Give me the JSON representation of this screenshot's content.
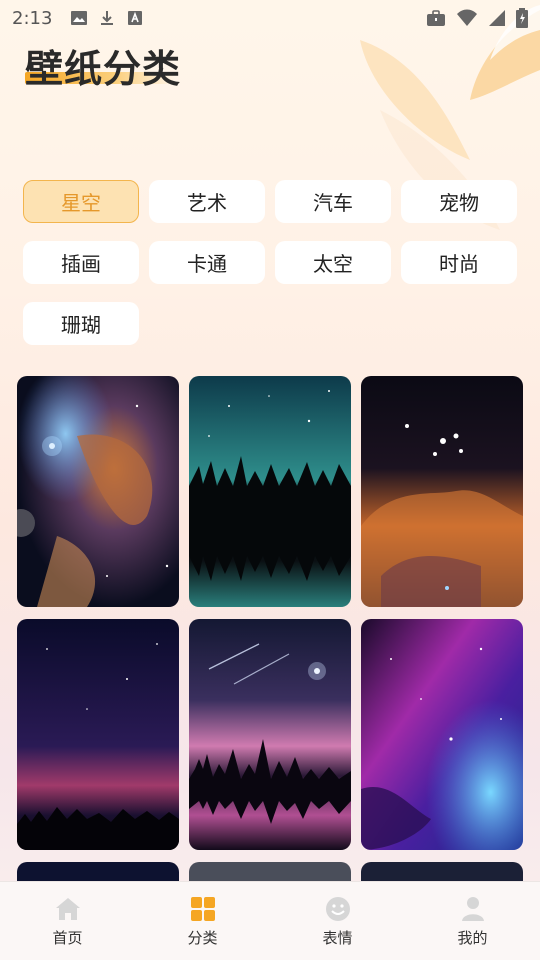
{
  "status_bar": {
    "time": "2:13",
    "left_icons": [
      "image-icon",
      "download-icon",
      "a-box-icon"
    ],
    "right_icons": [
      "briefcase-icon",
      "wifi-icon",
      "signal-icon",
      "battery-icon"
    ]
  },
  "header": {
    "title": "壁纸分类",
    "accent_color": "#f5a623"
  },
  "categories": [
    {
      "label": "星空",
      "selected": true
    },
    {
      "label": "艺术",
      "selected": false
    },
    {
      "label": "汽车",
      "selected": false
    },
    {
      "label": "宠物",
      "selected": false
    },
    {
      "label": "插画",
      "selected": false
    },
    {
      "label": "卡通",
      "selected": false
    },
    {
      "label": "太空",
      "selected": false
    },
    {
      "label": "时尚",
      "selected": false
    },
    {
      "label": "珊瑚",
      "selected": false
    }
  ],
  "wallpapers": [
    {
      "name": "nebula-cosmic-wallpaper"
    },
    {
      "name": "milky-way-forest-lake-wallpaper"
    },
    {
      "name": "orange-nebula-stars-wallpaper"
    },
    {
      "name": "night-sky-treeline-wallpaper"
    },
    {
      "name": "meteor-pink-sky-forest-wallpaper"
    },
    {
      "name": "purple-galaxy-clouds-wallpaper"
    }
  ],
  "tabbar": {
    "items": [
      {
        "label": "首页",
        "icon": "home-icon",
        "active": false
      },
      {
        "label": "分类",
        "icon": "category-grid-icon",
        "active": true
      },
      {
        "label": "表情",
        "icon": "emoji-icon",
        "active": false
      },
      {
        "label": "我的",
        "icon": "profile-icon",
        "active": false
      }
    ],
    "active_color": "#f5a623",
    "inactive_icon_color": "#d6d6d6"
  }
}
